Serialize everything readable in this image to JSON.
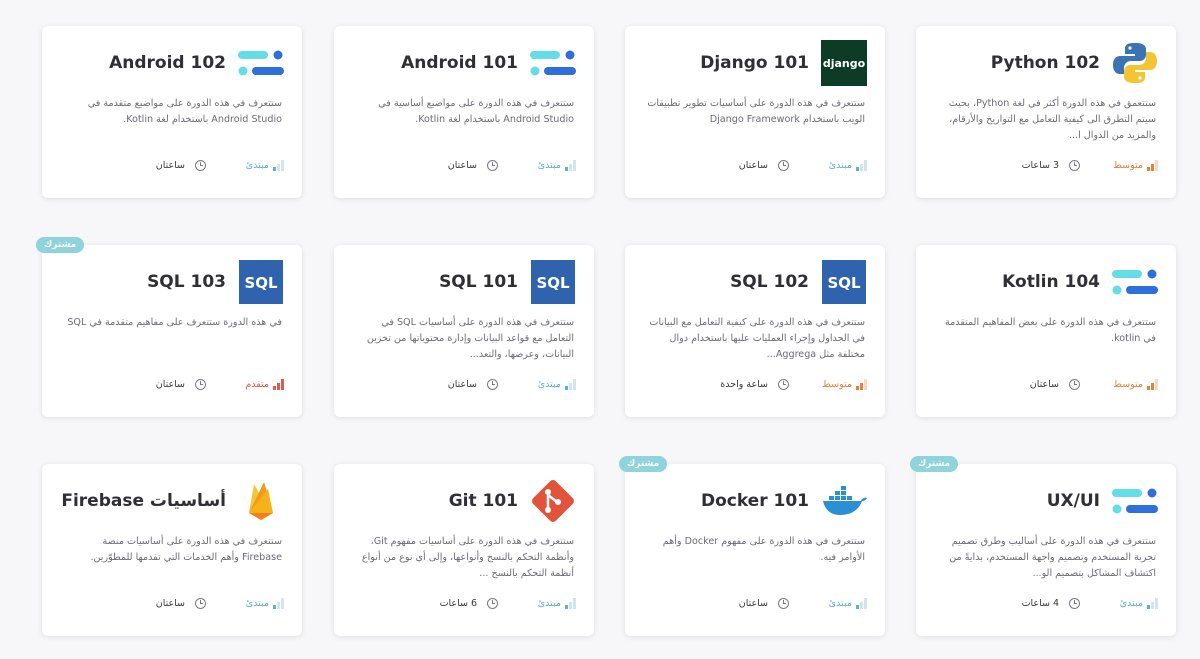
{
  "colors": {
    "beginner": "#5fb0d3",
    "intermediate": "#e6813a",
    "advanced": "#e05a4b",
    "badge": "#8fd3dc",
    "card_bg": "#ffffff",
    "page_bg": "#f7f7f9"
  },
  "cards": [
    {
      "title": "Python 102",
      "logo": "python-logo",
      "description": "ستتعمق في هذه الدورة أكثر في لغة Python، بحيث سيتم التطرق الى كيفية التعامل مع التواريخ والأرقام، والمزيد من الدوال ا...",
      "level": "متوسط",
      "level_kind": "intermediate",
      "duration": "3 ساعات",
      "badge": ""
    },
    {
      "title": "Django 101",
      "logo": "django-logo",
      "logo_text": "django",
      "description": "ستتعرف في هذه الدورة على أساسيات تطوير تطبيقات الويب باستخدام Django Framework",
      "level": "مبتدئ",
      "level_kind": "beginner",
      "duration": "ساعتان",
      "badge": ""
    },
    {
      "title": "Android 101",
      "logo": "kotlin-lines-logo",
      "description": "ستتعرف في هذه الدورة على مواضيع أساسية في Android Studio باستخدام لغة Kotlin.",
      "level": "مبتدئ",
      "level_kind": "beginner",
      "duration": "ساعتان",
      "badge": ""
    },
    {
      "title": "Android 102",
      "logo": "kotlin-lines-logo",
      "description": "ستتعرف في هذه الدورة على مواضيع متقدمة في Android Studio باستخدام لغة Kotlin.",
      "level": "مبتدئ",
      "level_kind": "beginner",
      "duration": "ساعتان",
      "badge": ""
    },
    {
      "title": "Kotlin 104",
      "logo": "kotlin-lines-logo",
      "description": "ستتعرف في هذه الدورة على بعض المفاهيم المتقدمة في kotlin.",
      "level": "متوسط",
      "level_kind": "intermediate",
      "duration": "ساعتان",
      "badge": ""
    },
    {
      "title": "SQL 102",
      "logo": "sql-logo",
      "logo_text": "SQL",
      "description": "ستتعرف في هذه الدورة على كيفية التعامل مع البيانات في الجداول وإجراء العمليات عليها باستخدام دوال مختلفة مثل Aggrega...",
      "level": "متوسط",
      "level_kind": "intermediate",
      "duration": "ساعة واحدة",
      "badge": ""
    },
    {
      "title": "SQL 101",
      "logo": "sql-logo",
      "logo_text": "SQL",
      "description": "ستتعرف في هذه الدورة على أساسيات SQL في التعامل مع قواعد البيانات وإدارة محتوياتها من تخزين البيانات، وعرضها، والتعد...",
      "level": "مبتدئ",
      "level_kind": "beginner",
      "duration": "ساعتان",
      "badge": ""
    },
    {
      "title": "SQL 103",
      "logo": "sql-logo",
      "logo_text": "SQL",
      "description": "في هذه الدورة ستتعرف على مفاهيم متقدمة في SQL",
      "level": "متقدم",
      "level_kind": "advanced",
      "duration": "ساعتان",
      "badge": "مشترك"
    },
    {
      "title": "UX/UI",
      "logo": "kotlin-lines-logo",
      "description": "ستتعرف في هذه الدورة على أساليب وطرق تصميم تجربة المستخدم وتصميم واجهة المستخدم، بدايةً من اكتشاف المشاكل بتصميم الو...",
      "level": "مبتدئ",
      "level_kind": "beginner",
      "duration": "4 ساعات",
      "badge": "مشترك"
    },
    {
      "title": "Docker 101",
      "logo": "docker-logo",
      "description": "ستتعرف في هذه الدورة على مفهوم Docker وأهم الأوامر فيه.",
      "level": "مبتدئ",
      "level_kind": "beginner",
      "duration": "ساعتان",
      "badge": "مشترك"
    },
    {
      "title": "Git 101",
      "logo": "git-logo",
      "description": "ستتعرف في هذه الدورة على أساسيات مفهوم Git، وأنظمة التحكم بالنسخ وأنواعها، وإلى أي نوع من أنواع أنظمة التحكم بالنسخ ...",
      "level": "مبتدئ",
      "level_kind": "beginner",
      "duration": "6 ساعات",
      "badge": ""
    },
    {
      "title": "أساسيات Firebase",
      "logo": "firebase-logo",
      "description": "ستتعرف في هذه الدورة على أساسيات منصة Firebase وأهم الخدمات التي تقدمها للمطوّرين.",
      "level": "مبتدئ",
      "level_kind": "beginner",
      "duration": "ساعتان",
      "badge": ""
    }
  ]
}
